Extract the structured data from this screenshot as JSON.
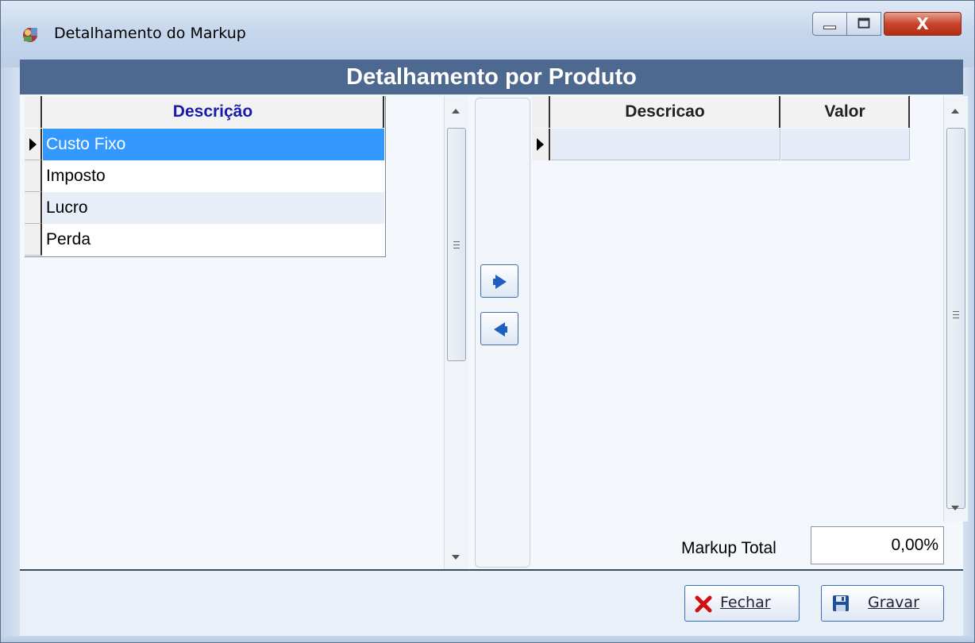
{
  "window": {
    "title": "Detalhamento do Markup",
    "close_glyph": "X"
  },
  "header": {
    "title": "Detalhamento por Produto"
  },
  "left_grid": {
    "column": "Descrição",
    "rows": [
      "Custo Fixo",
      "Imposto",
      "Lucro",
      "Perda"
    ],
    "selected_row": "Custo Fixo"
  },
  "right_grid": {
    "columns": [
      "Descricao",
      "Valor"
    ],
    "rows": [
      {
        "descricao": "",
        "valor": ""
      }
    ]
  },
  "markup": {
    "label": "Markup Total",
    "value": "0,00%"
  },
  "buttons": {
    "fechar": "Fechar",
    "gravar": "Gravar"
  },
  "icons": {
    "app": "app-icon",
    "move_right": "arrow-right-icon",
    "move_left": "arrow-left-icon",
    "close": "close-x-icon",
    "save": "floppy-disk-icon"
  },
  "colors": {
    "header_bg": "#4e6990",
    "selected_row": "#3399ff",
    "column_title": "#1a1aa8",
    "close_button": "#c8452c"
  }
}
